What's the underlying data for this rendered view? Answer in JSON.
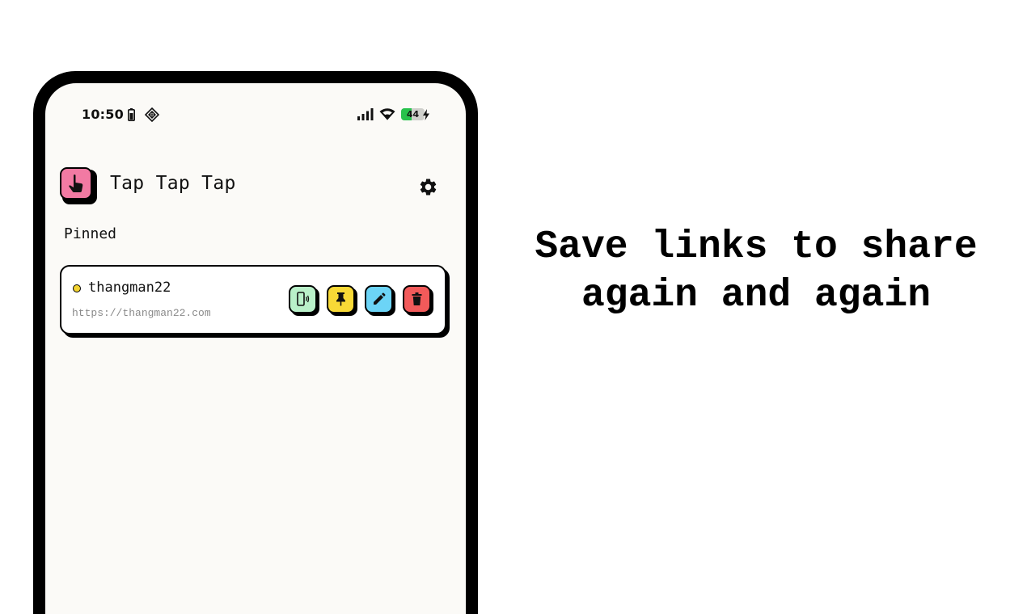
{
  "status_bar": {
    "time": "10:50",
    "battery_level": "44",
    "battery_fraction": 0.44,
    "icons": [
      "battery-saver-icon",
      "diamond-notification-icon",
      "signal-icon",
      "wifi-icon",
      "battery-icon",
      "charging-bolt-icon"
    ]
  },
  "app": {
    "title": "Tap Tap Tap",
    "logo_icon": "tap-finger-icon",
    "logo_color": "#f27aa3",
    "settings_icon": "gear-icon"
  },
  "pinned": {
    "section_title": "Pinned",
    "items": [
      {
        "name": "thangman22",
        "url": "https://thangman22.com",
        "status_color": "#f2d230",
        "actions": [
          {
            "icon": "phone-tap-icon",
            "color": "#b9f0c9"
          },
          {
            "icon": "pin-icon",
            "color": "#f8d936"
          },
          {
            "icon": "pencil-icon",
            "color": "#6cd4f6"
          },
          {
            "icon": "trash-icon",
            "color": "#f25a5a"
          }
        ]
      }
    ]
  },
  "headline": {
    "line1": "Save links to share",
    "line2": "again and again"
  }
}
